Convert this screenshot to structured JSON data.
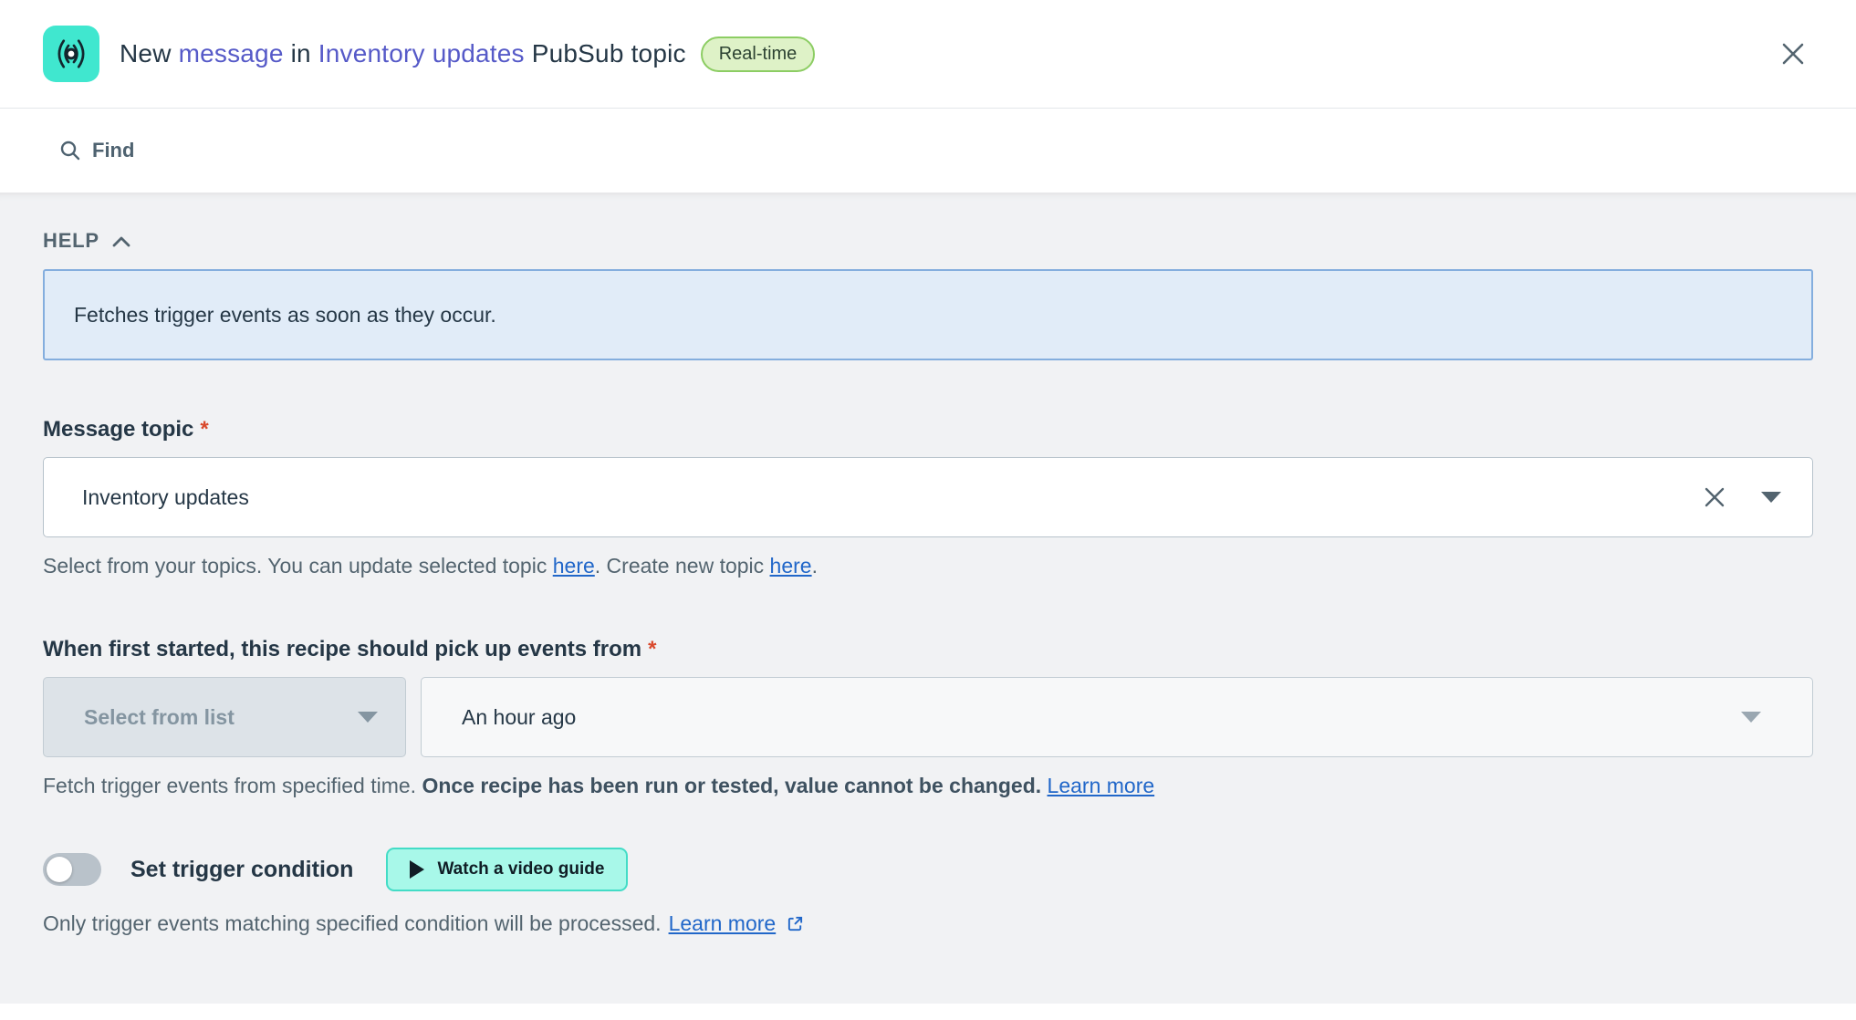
{
  "header": {
    "title": {
      "prefix": "New ",
      "link_message": "message",
      "infix": " in ",
      "link_topic": "Inventory updates",
      "suffix": " PubSub topic"
    },
    "badge": "Real-time",
    "icon": "pubsub-broadcast-icon"
  },
  "search": {
    "label": "Find"
  },
  "help": {
    "heading": "HELP",
    "text": "Fetches trigger events as soon as they occur."
  },
  "fields": {
    "message_topic": {
      "label": "Message topic",
      "required_mark": "*",
      "value": "Inventory updates",
      "hint_text1": "Select from your topics. You can update selected topic ",
      "hint_link1": "here",
      "hint_text2": ". Create new topic ",
      "hint_link2": "here",
      "hint_text3": "."
    },
    "pickup": {
      "label": "When first started, this recipe should pick up events from",
      "required_mark": "*",
      "list_placeholder": "Select from list",
      "value": "An hour ago",
      "hint_normal": "Fetch trigger events from specified time. ",
      "hint_bold": "Once recipe has been run or tested, value cannot be changed.",
      "hint_link": "Learn more"
    },
    "trigger_condition": {
      "label": "Set trigger condition",
      "toggle_state": "off",
      "video_button": "Watch a video guide",
      "hint_text": "Only trigger events matching specified condition will be processed.",
      "hint_link": "Learn more"
    }
  },
  "colors": {
    "accent_teal": "#40e7cf",
    "badge_green_bg": "#def2c7",
    "badge_green_border": "#8ccd63",
    "help_box_bg": "#e1ecf8",
    "help_box_border": "#84aede",
    "title_link": "#565ac8",
    "body_link": "#2167c9",
    "required_red": "#d9482b",
    "content_bg": "#f1f2f4",
    "video_button_bg": "#a8f8e9",
    "video_button_border": "#43dcc6"
  }
}
